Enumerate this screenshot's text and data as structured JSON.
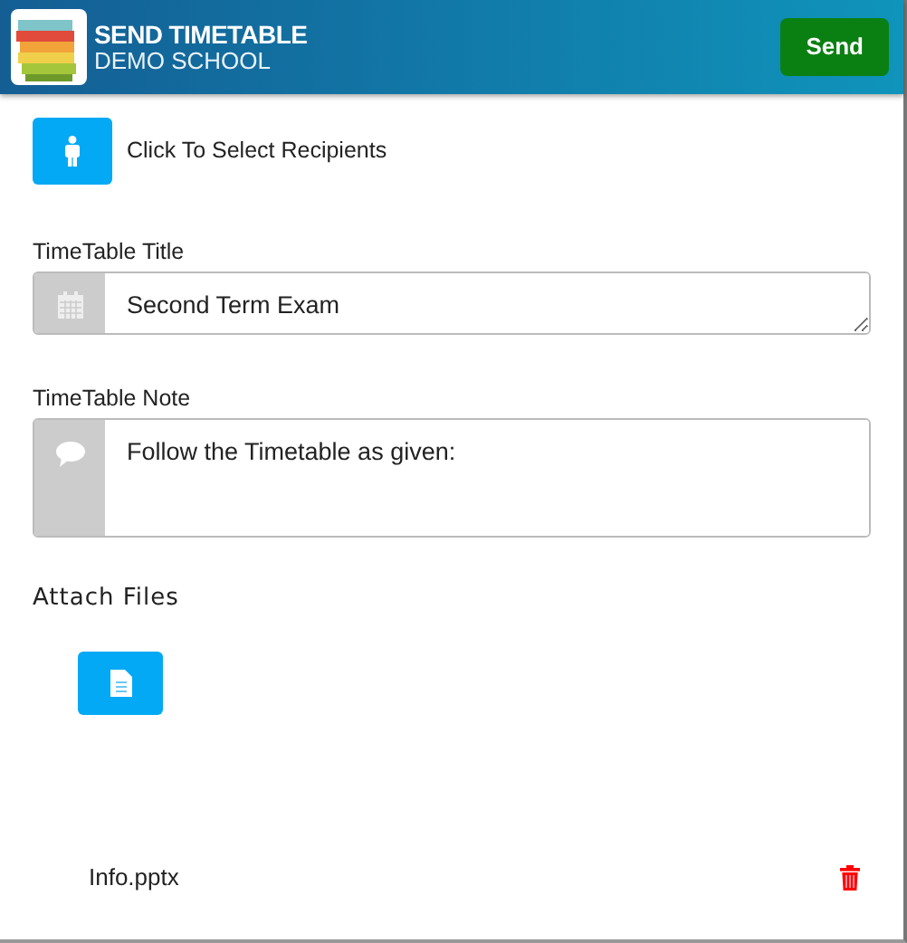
{
  "header": {
    "title": "SEND TIMETABLE",
    "subtitle": "DEMO SCHOOL",
    "send_button": "Send"
  },
  "recipients": {
    "label": "Click To Select Recipients"
  },
  "fields": [
    {
      "kind": "title",
      "label": "TimeTable Title",
      "value": "Second Term Exam"
    },
    {
      "kind": "note",
      "label": "TimeTable Note",
      "value": "Follow the Timetable as given:"
    }
  ],
  "attach": {
    "heading": "Attach Files"
  },
  "files": [
    {
      "name": "Info.pptx"
    }
  ]
}
